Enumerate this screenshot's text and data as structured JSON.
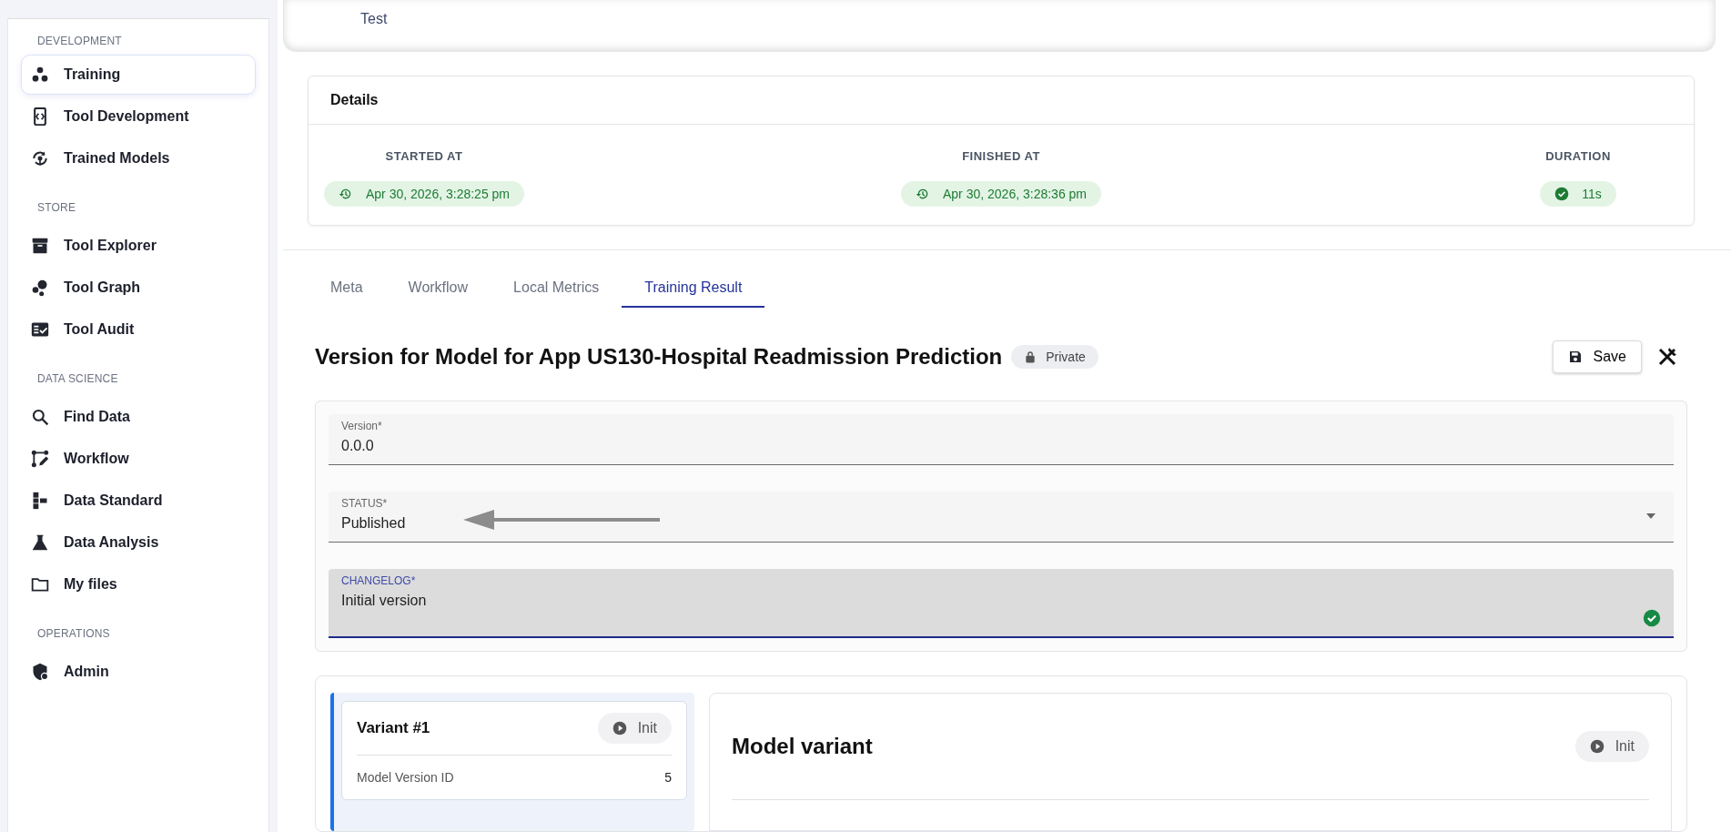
{
  "sidebar": {
    "sections": [
      {
        "title": "DEVELOPMENT",
        "items": [
          {
            "label": "Training",
            "selected": true
          },
          {
            "label": "Tool Development",
            "selected": false
          },
          {
            "label": "Trained Models",
            "selected": false
          }
        ]
      },
      {
        "title": "STORE",
        "items": [
          {
            "label": "Tool Explorer",
            "selected": false
          },
          {
            "label": "Tool Graph",
            "selected": false
          },
          {
            "label": "Tool Audit",
            "selected": false
          }
        ]
      },
      {
        "title": "DATA SCIENCE",
        "items": [
          {
            "label": "Find Data",
            "selected": false
          },
          {
            "label": "Workflow",
            "selected": false
          },
          {
            "label": "Data Standard",
            "selected": false
          },
          {
            "label": "Data Analysis",
            "selected": false
          },
          {
            "label": "My files",
            "selected": false
          }
        ]
      },
      {
        "title": "OPERATIONS",
        "items": [
          {
            "label": "Admin",
            "selected": false
          }
        ]
      }
    ]
  },
  "header": {
    "subtitle": "Test"
  },
  "details": {
    "title": "Details",
    "columns": [
      {
        "label": "STARTED AT",
        "value": "Apr 30, 2026, 3:28:25 pm",
        "kind": "time"
      },
      {
        "label": "FINISHED AT",
        "value": "Apr 30, 2026, 3:28:36 pm",
        "kind": "time"
      },
      {
        "label": "DURATION",
        "value": "11s",
        "kind": "duration"
      }
    ]
  },
  "tabs": [
    {
      "label": "Meta",
      "selected": false
    },
    {
      "label": "Workflow",
      "selected": false
    },
    {
      "label": "Local Metrics",
      "selected": false
    },
    {
      "label": "Training Result",
      "selected": true
    }
  ],
  "version": {
    "title": "Version for Model for App US130-Hospital Readmission Prediction",
    "visibility": "Private",
    "save": "Save"
  },
  "form": {
    "fields": [
      {
        "kind": "text",
        "label": "Version*",
        "value": "0.0.0",
        "focused": false,
        "valid": false,
        "pointer_arrow": false
      },
      {
        "kind": "select",
        "label": "STATUS*",
        "value": "Published",
        "focused": false,
        "valid": false,
        "pointer_arrow": true
      },
      {
        "kind": "text",
        "label": "CHANGELOG*",
        "value": "Initial version",
        "focused": true,
        "valid": true,
        "pointer_arrow": false
      }
    ]
  },
  "variants": [
    {
      "title": "Variant #1",
      "status": "Init",
      "selected": true,
      "rows": [
        {
          "label": "Model Version ID",
          "value": "5"
        }
      ]
    }
  ],
  "variant_detail": {
    "title": "Model variant",
    "status": "Init"
  }
}
